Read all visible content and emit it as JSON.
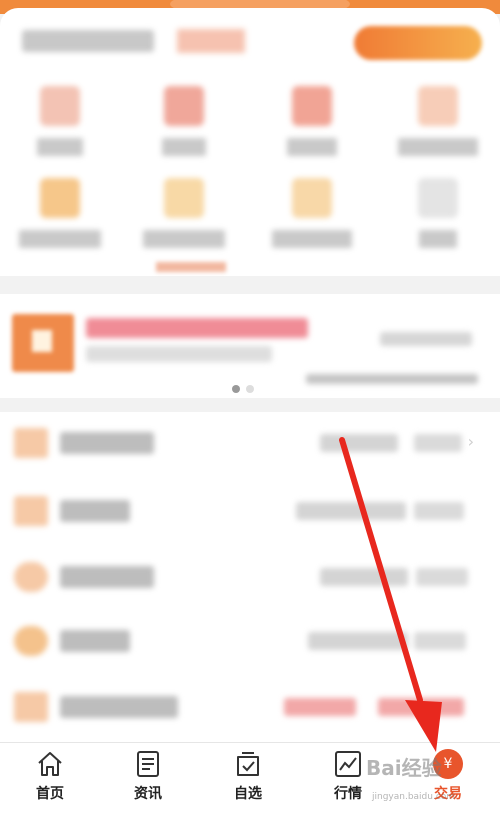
{
  "tab_bar": {
    "items": [
      {
        "name": "home",
        "label": "首页"
      },
      {
        "name": "news",
        "label": "资讯"
      },
      {
        "name": "watchlist",
        "label": "自选"
      },
      {
        "name": "market",
        "label": "行情"
      },
      {
        "name": "trade",
        "label": "交易",
        "icon_glyph": "¥"
      }
    ],
    "active": "trade"
  },
  "icons": {
    "home": "home-icon",
    "news": "document-icon",
    "watchlist": "checkbox-icon",
    "market": "chart-icon",
    "trade": "yuan-icon",
    "row_chevron": "chevron-right-icon"
  },
  "watermark": {
    "text": "Bai经验",
    "sub": "jingyan.baidu.com"
  },
  "colors": {
    "accent": "#e8552c",
    "header_orange": "#f08a3c",
    "annotation_arrow": "#e8281e"
  }
}
